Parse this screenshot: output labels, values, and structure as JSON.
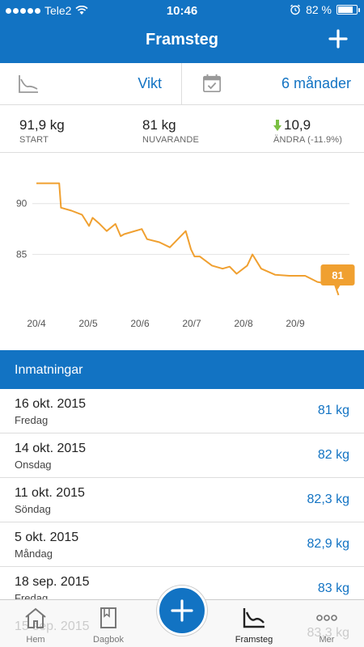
{
  "status_bar": {
    "carrier": "Tele2",
    "time": "10:46",
    "battery_percent": "82 %",
    "battery_level": 0.82
  },
  "nav": {
    "title": "Framsteg",
    "add_icon": "plus-icon"
  },
  "filters": {
    "metric": {
      "label": "Vikt",
      "icon": "chart-line-icon"
    },
    "period": {
      "label": "6 månader",
      "icon": "calendar-icon"
    }
  },
  "stats": {
    "start": {
      "value": "91,9 kg",
      "label": "START"
    },
    "current": {
      "value": "81 kg",
      "label": "NUVARANDE"
    },
    "change": {
      "value": "10,9",
      "label": "ÄNDRA (-11.9%)",
      "icon": "arrow-down-icon"
    }
  },
  "chart_data": {
    "type": "line",
    "x_tick_labels": [
      "20/4",
      "20/5",
      "20/6",
      "20/7",
      "20/8",
      "20/9"
    ],
    "y_ticks": [
      90,
      85
    ],
    "ylim": [
      79.8,
      93.0
    ],
    "xlim_days": [
      0,
      175
    ],
    "grid": true,
    "line_color": "#f0a030",
    "series": [
      {
        "x_days": [
          0,
          13,
          14,
          20,
          26,
          30,
          32,
          36,
          40,
          45,
          48,
          50,
          60,
          63,
          70,
          76,
          85,
          88,
          90,
          93,
          100,
          106,
          110,
          114,
          120,
          123,
          128,
          136,
          144,
          146,
          150,
          153,
          160,
          170,
          172
        ],
        "values": [
          92.0,
          92.0,
          89.6,
          89.3,
          88.9,
          87.8,
          88.6,
          88.0,
          87.3,
          88.0,
          86.8,
          87.0,
          87.5,
          86.5,
          86.2,
          85.7,
          87.3,
          85.5,
          84.8,
          84.8,
          83.9,
          83.6,
          83.8,
          83.1,
          83.9,
          85.0,
          83.6,
          83.0,
          82.9,
          82.9,
          82.9,
          82.9,
          82.3,
          82.0,
          81.0
        ]
      }
    ],
    "last_value_label": "81"
  },
  "entries_section": {
    "title": "Inmatningar"
  },
  "entries": [
    {
      "date": "16 okt. 2015",
      "day": "Fredag",
      "weight": "81 kg"
    },
    {
      "date": "14 okt. 2015",
      "day": "Onsdag",
      "weight": "82 kg"
    },
    {
      "date": "11 okt. 2015",
      "day": "Söndag",
      "weight": "82,3 kg"
    },
    {
      "date": "5 okt. 2015",
      "day": "Måndag",
      "weight": "82,9 kg"
    },
    {
      "date": "18 sep. 2015",
      "day": "Fredag",
      "weight": "83 kg"
    }
  ],
  "ghost_entry": {
    "date": "15 sep. 2015",
    "weight": "83,3 kg"
  },
  "tabs": [
    {
      "label": "Hem",
      "icon": "home-icon"
    },
    {
      "label": "Dagbok",
      "icon": "book-icon"
    },
    {
      "label": "",
      "icon": "plus-icon"
    },
    {
      "label": "Framsteg",
      "icon": "progress-chart-icon",
      "active": true
    },
    {
      "label": "Mer",
      "icon": "more-icon"
    }
  ],
  "colors": {
    "brand": "#1273c3",
    "accent": "#f0a030",
    "down_arrow": "#7bc043"
  }
}
